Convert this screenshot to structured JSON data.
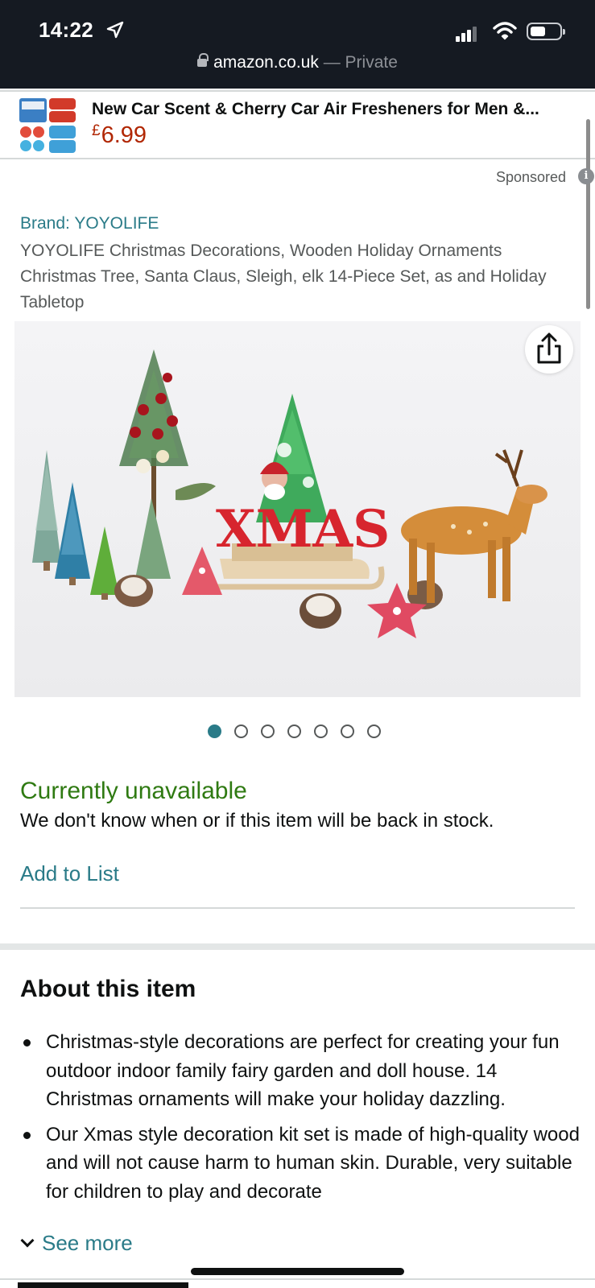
{
  "status_bar": {
    "time": "14:22",
    "url": "amazon.co.uk",
    "private_label": "— Private"
  },
  "ad": {
    "title": "New Car Scent & Cherry Car Air Fresheners for Men &...",
    "currency": "£",
    "price": "6.99",
    "sponsored_label": "Sponsored",
    "info_icon_glyph": "i"
  },
  "product": {
    "brand": "Brand: YOYOLIFE",
    "title": "YOYOLIFE Christmas Decorations, Wooden Holiday Ornaments Christmas Tree, Santa Claus, Sleigh, elk 14-Piece Set, as and Holiday Tabletop",
    "image_sign_text": "XMAS",
    "image_count": 7,
    "active_image_index": 0
  },
  "availability": {
    "status": "Currently unavailable",
    "detail": "We don't know when or if this item will be back in stock.",
    "add_to_list_label": "Add to List"
  },
  "about": {
    "heading": "About this item",
    "bullets": [
      "Christmas-style decorations are perfect for creating your fun outdoor indoor family fairy garden and doll house. 14 Christmas ornaments will make your holiday dazzling.",
      "Our Xmas style decoration kit set is made of high-quality wood and will not cause harm to human skin. Durable, very suitable for children to play and decorate"
    ],
    "see_more_label": "See more"
  },
  "colors": {
    "link": "#2a7b88",
    "price": "#b12704",
    "available_status": "#2f7a12",
    "topbar": "#151a22"
  },
  "icons": {
    "location": "location-arrow-icon",
    "signal": "cellular-signal-icon",
    "wifi": "wifi-icon",
    "battery": "battery-icon",
    "lock": "lock-icon",
    "info": "info-icon",
    "share": "share-icon",
    "chevron": "chevron-down-icon"
  }
}
